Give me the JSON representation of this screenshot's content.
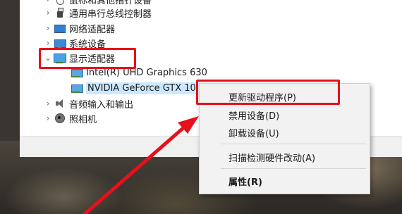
{
  "device_tree": {
    "items": [
      {
        "label": "鼠标和其他指针设备",
        "icon": "mouse-icon",
        "expanded": false
      },
      {
        "label": "通用串行总线控制器",
        "icon": "usb-icon",
        "expanded": false
      },
      {
        "label": "网络适配器",
        "icon": "network-adapter-icon",
        "expanded": false
      },
      {
        "label": "系统设备",
        "icon": "system-device-icon",
        "expanded": false
      },
      {
        "label": "显示适配器",
        "icon": "display-adapter-icon",
        "expanded": true
      },
      {
        "label": "音频输入和输出",
        "icon": "speaker-icon",
        "expanded": false
      },
      {
        "label": "照相机",
        "icon": "camera-icon",
        "expanded": false
      }
    ],
    "display_children": [
      {
        "label": "Intel(R) UHD Graphics 630",
        "icon": "gpu-icon"
      },
      {
        "label": "NVIDIA GeForce GTX 10",
        "icon": "gpu-icon",
        "selected": true
      }
    ],
    "chevron_collapsed": "›",
    "chevron_expanded": "⌄"
  },
  "context_menu": {
    "items": [
      {
        "label": "更新驱动程序(P)"
      },
      {
        "label": "禁用设备(D)"
      },
      {
        "label": "卸载设备(U)"
      },
      {
        "label": "扫描检测硬件改动(A)"
      },
      {
        "label": "属性(R)",
        "bold": true
      }
    ]
  },
  "colors": {
    "highlight": "#e8101a",
    "selection": "#cce8ff",
    "menu_bg": "#f2f2f2"
  }
}
